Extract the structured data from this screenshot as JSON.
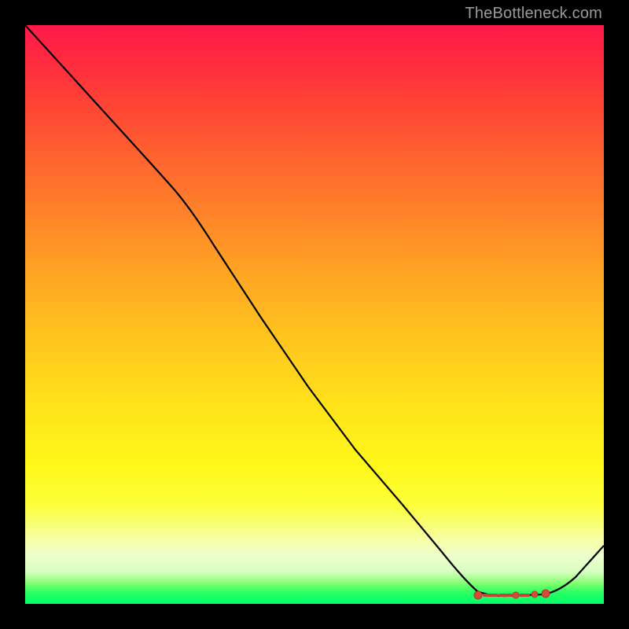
{
  "watermark": "TheBottleneck.com",
  "chart_data": {
    "type": "line",
    "title": "",
    "xlabel": "",
    "ylabel": "",
    "x": [
      0.0,
      0.05,
      0.1,
      0.15,
      0.2,
      0.25,
      0.3,
      0.35,
      0.4,
      0.45,
      0.5,
      0.55,
      0.6,
      0.65,
      0.7,
      0.75,
      0.78,
      0.8,
      0.82,
      0.84,
      0.86,
      0.88,
      0.9,
      1.0
    ],
    "y": [
      1.0,
      0.94,
      0.88,
      0.82,
      0.76,
      0.7,
      0.61,
      0.52,
      0.44,
      0.36,
      0.28,
      0.2,
      0.13,
      0.07,
      0.03,
      0.015,
      0.012,
      0.012,
      0.012,
      0.012,
      0.013,
      0.015,
      0.017,
      0.1
    ],
    "xlim": [
      0,
      1
    ],
    "ylim": [
      0,
      1
    ],
    "marker_cluster": {
      "x_range": [
        0.78,
        0.89
      ],
      "y": 0.014,
      "count": 8
    },
    "background_gradient": {
      "top": "#ff1a4a",
      "mid": "#ffe31a",
      "bottom": "#00ff6a"
    }
  }
}
